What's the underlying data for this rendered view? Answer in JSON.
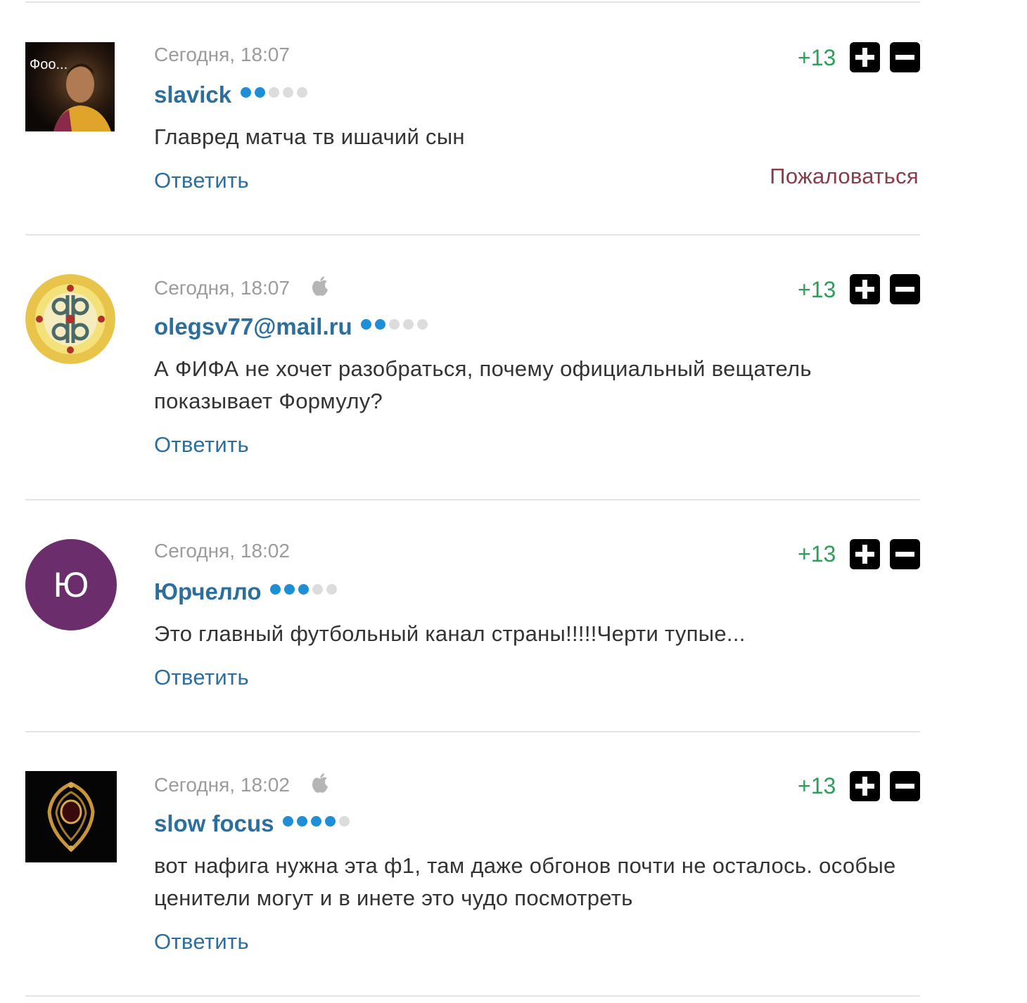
{
  "comments": [
    {
      "date": "Сегодня, 18:07",
      "device_icon": "none",
      "author": "slavick",
      "level": 2,
      "text": "Главред матча тв ишачий сын",
      "rating": "+13",
      "reply_label": "Ответить",
      "complain_label": "Пожаловаться",
      "avatar": {
        "type": "photo",
        "overlay_text": "Фоо..."
      }
    },
    {
      "date": "Сегодня, 18:07",
      "device_icon": "apple-icon",
      "author": "olegsv77@mail.ru",
      "level": 2,
      "text": "А ФИФА не хочет разобраться, почему официальный вещатель показывает Формулу?",
      "rating": "+13",
      "reply_label": "Ответить",
      "avatar": {
        "type": "ornament"
      }
    },
    {
      "date": "Сегодня, 18:02",
      "device_icon": "none",
      "author": "Юрчелло",
      "level": 3,
      "text": "Это главный футбольный канал страны!!!!!Черти тупые...",
      "rating": "+13",
      "reply_label": "Ответить",
      "avatar": {
        "type": "letter",
        "letter": "Ю",
        "color": "#6b2d6b"
      }
    },
    {
      "date": "Сегодня, 18:02",
      "device_icon": "apple-icon",
      "author": "slow focus",
      "level": 4,
      "text": "вот нафига нужна эта ф1, там даже обгонов почти не осталось. особые ценители могут и в инете это чудо посмотреть",
      "rating": "+13",
      "reply_label": "Ответить",
      "avatar": {
        "type": "jewel"
      }
    }
  ],
  "level_max": 5,
  "colors": {
    "author": "#2c6e9e",
    "rating": "#2e9e5a",
    "complain": "#8a3b48",
    "level_on": "#1e8fd6",
    "level_off": "#dcdcdc"
  }
}
